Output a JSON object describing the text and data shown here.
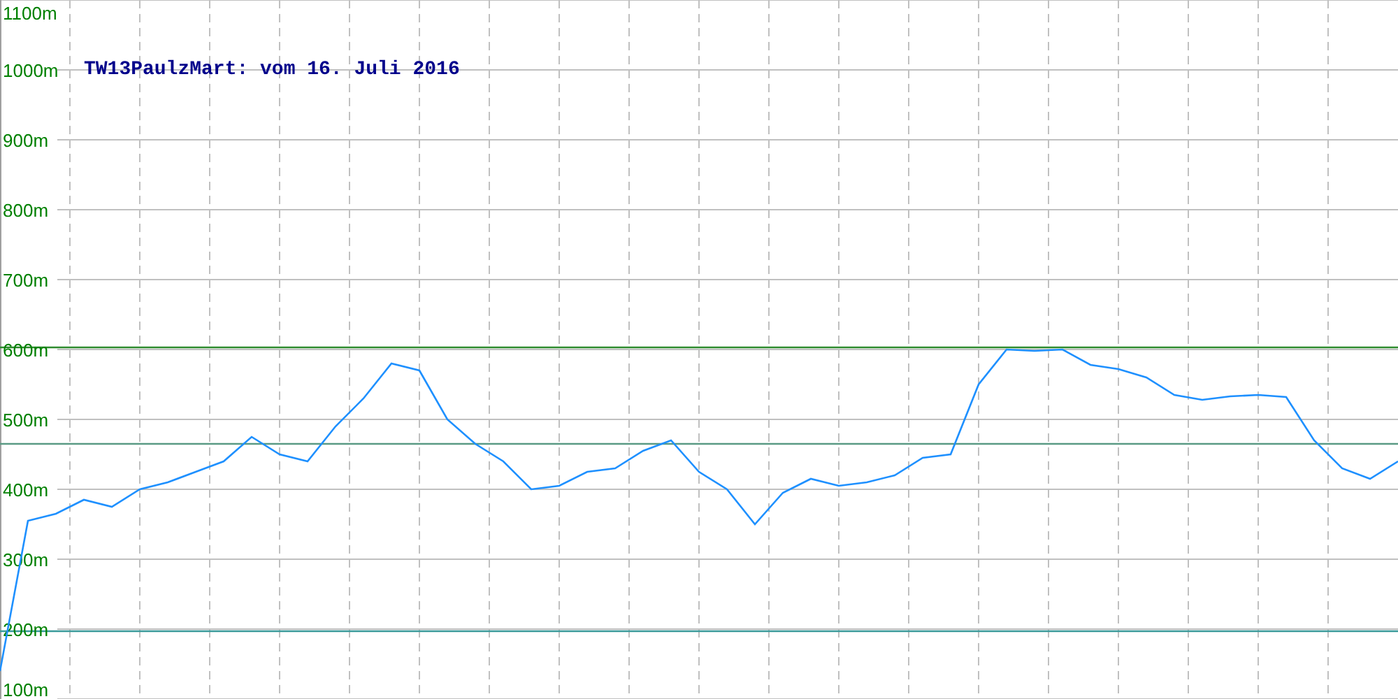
{
  "chart_data": {
    "type": "line",
    "title": "TW13PaulzMart: vom 16. Juli 2016",
    "ylim": [
      100,
      1100
    ],
    "grid": true,
    "yticks": [
      {
        "value": 100,
        "label": "100m"
      },
      {
        "value": 200,
        "label": "200m"
      },
      {
        "value": 300,
        "label": "300m"
      },
      {
        "value": 400,
        "label": "400m"
      },
      {
        "value": 500,
        "label": "500m"
      },
      {
        "value": 600,
        "label": "600m"
      },
      {
        "value": 700,
        "label": "700m"
      },
      {
        "value": 800,
        "label": "800m"
      },
      {
        "value": 900,
        "label": "900m"
      },
      {
        "value": 1000,
        "label": "1000m"
      },
      {
        "value": 1100,
        "label": "1100m"
      }
    ],
    "series": [
      {
        "color": "#1e90ff",
        "values": [
          140,
          355,
          365,
          385,
          375,
          400,
          410,
          425,
          440,
          475,
          450,
          440,
          490,
          530,
          580,
          570,
          500,
          465,
          440,
          400,
          405,
          425,
          430,
          455,
          470,
          425,
          400,
          350,
          395,
          415,
          405,
          410,
          420,
          445,
          450,
          550,
          600,
          598,
          600,
          578,
          572,
          560,
          535,
          528,
          533,
          535,
          532,
          470,
          430,
          415,
          440
        ]
      }
    ],
    "ref_lines": [
      {
        "axis": "y",
        "value": 603,
        "color": "#2e8b2e"
      },
      {
        "axis": "y",
        "value": 465,
        "color": "#5a9a84"
      },
      {
        "axis": "y",
        "value": 197,
        "color": "#3a9a9a"
      }
    ]
  }
}
